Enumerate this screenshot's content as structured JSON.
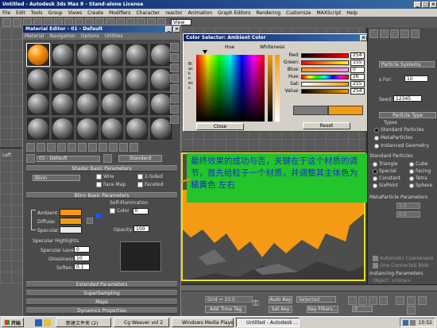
{
  "app": {
    "title": "Untitled - Autodesk 3ds Max 8 - Stand-alone License",
    "menu": [
      "File",
      "Edit",
      "Tools",
      "Group",
      "Views",
      "Create",
      "Modifiers",
      "Character",
      "reactor",
      "Animation",
      "Graph Editors",
      "Rendering",
      "Customize",
      "MAXScript",
      "Help"
    ],
    "toolbar_dropdown": "View"
  },
  "material_editor": {
    "title": "Material Editor - 01 - Default",
    "menu": [
      "Material",
      "Navigation",
      "Options",
      "Utilities"
    ],
    "material_name": "01 - Default",
    "material_type": "Standard",
    "shader_rollout": "Shader Basic Parameters",
    "shader_type": "Blinn",
    "shader_options": [
      "Wire",
      "2-Sided",
      "Face Map",
      "Faceted"
    ],
    "blinn_rollout": "Blinn Basic Parameters",
    "self_illumination": "Self-Illumination",
    "color_label": "Color",
    "color_value": "0",
    "ambient_label": "Ambient:",
    "diffuse_label": "Diffuse:",
    "specular_label": "Specular:",
    "opacity_label": "Opacity:",
    "opacity_value": "100",
    "specular_highlights": "Specular Highlights",
    "specular_level_label": "Specular Level:",
    "specular_level_value": "0",
    "glossiness_label": "Glossiness:",
    "glossiness_value": "10",
    "soften_label": "Soften:",
    "soften_value": "0.1",
    "rollouts": [
      "Extended Parameters",
      "SuperSampling",
      "Maps",
      "Dynamics Properties"
    ],
    "ambient_color": "#f59a14",
    "diffuse_color": "#f59a14",
    "specular_color": "#e8e8e8"
  },
  "color_selector": {
    "title": "Color Selector: Ambient Color",
    "hue_label": "Hue",
    "whiteness_label": "Whiteness",
    "blackness_label": "Blackness",
    "channels": [
      {
        "label": "Red:",
        "value": "254",
        "color": "#d02020"
      },
      {
        "label": "Green:",
        "value": "155",
        "color": "#20a020"
      },
      {
        "label": "Blue:",
        "value": "0",
        "color": "#2050d0"
      },
      {
        "label": "Hue:",
        "value": "26",
        "color": "#c08020"
      },
      {
        "label": "Sat:",
        "value": "255",
        "color": "#808080"
      },
      {
        "label": "Value:",
        "value": "254",
        "color": "#a0a0a0"
      }
    ],
    "close_label": "Close",
    "reset_label": "Reset",
    "swatch_old": "#7a7a7a",
    "swatch_new": "#f59a14"
  },
  "annotation": {
    "text": "最终效果的成功与否，关键在于这个材质的调节，首先给粒子一个材质，并调整其主体色为 橘黄色 左右",
    "bg_color": "#22c52a",
    "text_color": "#1a2fd0"
  },
  "command_panel": {
    "system_dropdown": "Particle Systems",
    "field1_label": "s For:",
    "field1_value": "10",
    "field2_label": "Seed:",
    "field2_value": "12345",
    "particle_type_rollout": "Particle Type",
    "types_label": "Types",
    "radio_types": [
      "Standard Particles",
      "MetaParticles",
      "Instanced Geometry"
    ],
    "standard_particles_label": "Standard Particles",
    "shapes": [
      "Triangle",
      "Cube",
      "Special",
      "Facing",
      "Constant",
      "Tetra",
      "SixPoint",
      "Sphere"
    ],
    "meta_params_label": "MetaParticle Parameters",
    "meta_field1": "1.0",
    "meta_field2": "0.0",
    "auto_coarseness": "Automatic Coarseness",
    "one_connected": "One Connected Blob",
    "instancing_label": "Instancing Parameters",
    "object_label": "Object: <none>"
  },
  "bottom_bar": {
    "grid_label": "Grid = 10.0",
    "auto_key": "Auto Key",
    "selected": "Selected",
    "set_key": "Set Key",
    "key_filters": "Key Filters...",
    "add_time_tag": "Add Time Tag",
    "time_frame": "0"
  },
  "taskbar": {
    "start": "开始",
    "tasks": [
      "新建文件夹 (2)",
      "Cg Weaver vol 2",
      "Windows Media Player",
      "Untitled - Autodesk ..."
    ],
    "clock": "10:52"
  },
  "viewport_left_label": "Left"
}
